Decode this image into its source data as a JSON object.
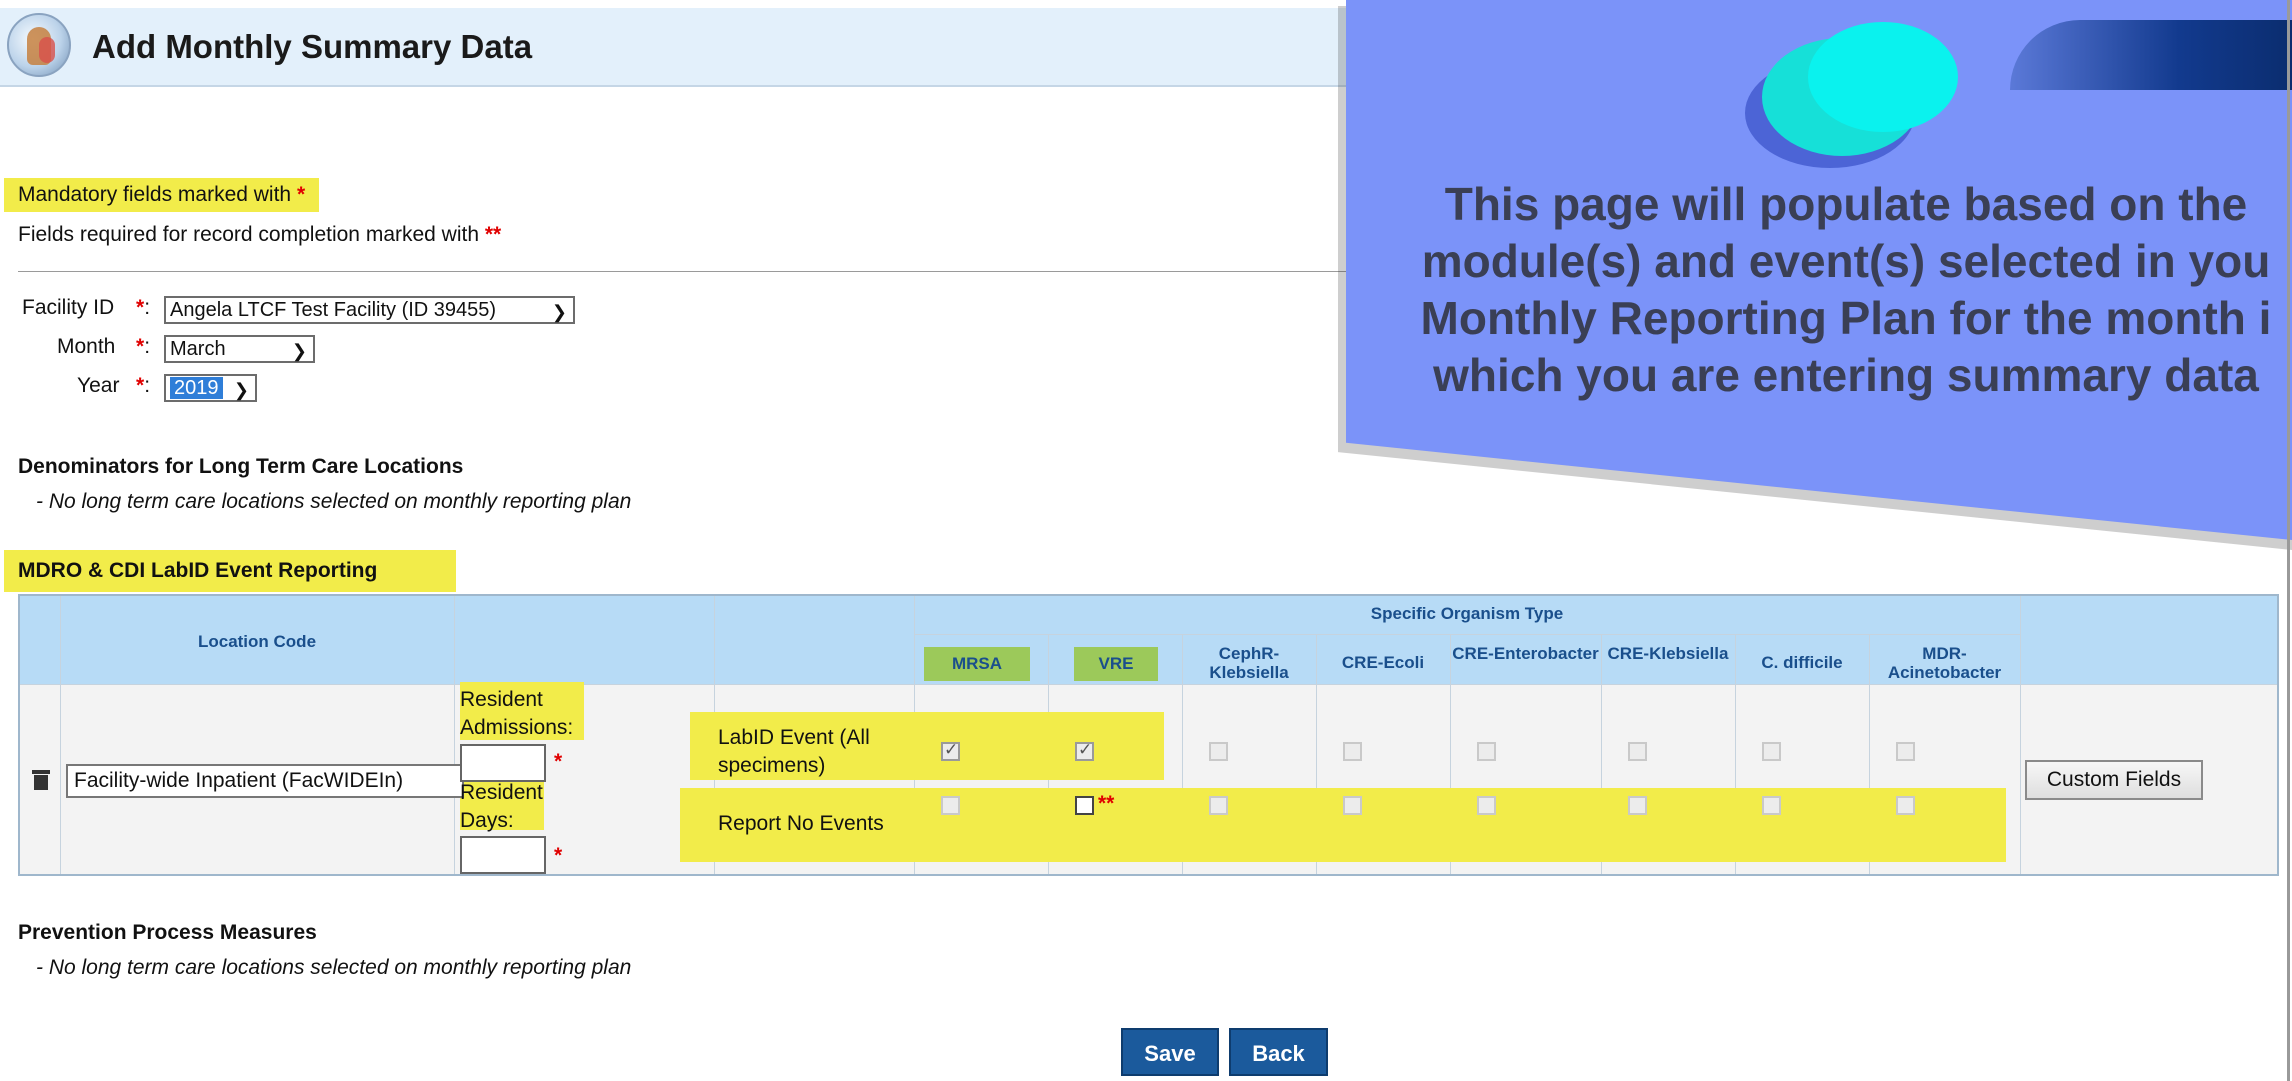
{
  "header": {
    "title": "Add Monthly Summary Data",
    "logo_icon": "nhsn-logo-icon"
  },
  "notes": {
    "mandatory": "Mandatory fields marked with",
    "mandatory_marker": "*",
    "completion": "Fields required for record completion marked with",
    "completion_marker": "**"
  },
  "form": {
    "facility_label": "Facility ID",
    "facility_value": "Angela LTCF Test Facility (ID 39455)",
    "month_label": "Month",
    "month_value": "March",
    "year_label": "Year",
    "year_value": "2019",
    "label_suffix": ":"
  },
  "denominators": {
    "title": "Denominators for Long Term Care Locations",
    "note": "- No long term care locations selected on monthly reporting plan"
  },
  "mdro": {
    "title": "MDRO & CDI LabID Event Reporting",
    "table": {
      "location_code_header": "Location Code",
      "organism_group_header": "Specific Organism Type",
      "organisms": [
        "MRSA",
        "VRE",
        "CephR-Klebsiella",
        "CRE-Ecoli",
        "CRE-Enterobacter",
        "CRE-Klebsiella",
        "C. difficile",
        "MDR-Acinetobacter"
      ],
      "row": {
        "location_value": "Facility-wide Inpatient (FacWIDEIn)",
        "resident_admissions_label": "Resident Admissions:",
        "resident_days_label": "Resident Days:",
        "labid_label": "LabID Event (All specimens)",
        "no_events_label": "Report No Events",
        "labid_checked": [
          true,
          true,
          false,
          false,
          false,
          false,
          false,
          false
        ],
        "custom_fields_button": "Custom Fields"
      }
    }
  },
  "prevention": {
    "title": "Prevention Process Measures",
    "note": "- No long term care locations selected on monthly reporting plan"
  },
  "buttons": {
    "save": "Save",
    "back": "Back"
  },
  "callout": {
    "text": "This page will populate based on the\nmodule(s) and event(s) selected in you\nMonthly Reporting Plan for the month i\nwhich you are entering summary data"
  },
  "colors": {
    "highlight": "#f2ec4a",
    "header_bg": "#e3f0fb",
    "table_header": "#b7dbf6",
    "organism_badge": "#9cc95a",
    "button": "#1b5a9c",
    "callout": "#7b93f9",
    "required": "#e00000"
  }
}
